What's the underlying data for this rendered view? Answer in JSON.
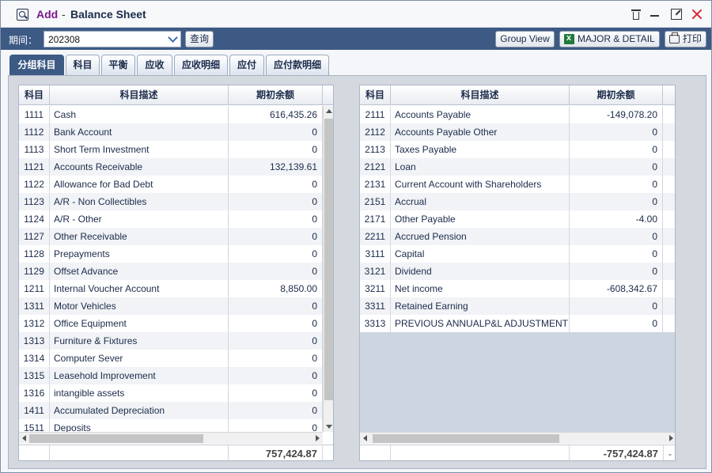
{
  "title": {
    "mode": "Add",
    "separator": "-",
    "name": "Balance Sheet"
  },
  "toolbar": {
    "period_label": "期间：",
    "period_value": "202308",
    "query_label": "查询",
    "group_view_label": "Group View",
    "major_detail_label": "MAJOR & DETAIL",
    "print_label": "打印"
  },
  "tabs": [
    {
      "label": "分组科目",
      "active": true
    },
    {
      "label": "科目"
    },
    {
      "label": "平衡"
    },
    {
      "label": "应收"
    },
    {
      "label": "应收明细"
    },
    {
      "label": "应付"
    },
    {
      "label": "应付款明细"
    }
  ],
  "columns": {
    "code": "科目",
    "desc": "科目描述",
    "amount": "期初余额"
  },
  "assets": {
    "rows": [
      {
        "code": "1111",
        "desc": "Cash",
        "amount": "616,435.26"
      },
      {
        "code": "1112",
        "desc": "Bank Account",
        "amount": "0"
      },
      {
        "code": "1113",
        "desc": "Short Term Investment",
        "amount": "0"
      },
      {
        "code": "1121",
        "desc": "Accounts Receivable",
        "amount": "132,139.61"
      },
      {
        "code": "1122",
        "desc": "Allowance for Bad Debt",
        "amount": "0"
      },
      {
        "code": "1123",
        "desc": "A/R - Non Collectibles",
        "amount": "0"
      },
      {
        "code": "1124",
        "desc": "A/R - Other",
        "amount": "0"
      },
      {
        "code": "1127",
        "desc": "Other Receivable",
        "amount": "0"
      },
      {
        "code": "1128",
        "desc": "Prepayments",
        "amount": "0"
      },
      {
        "code": "1129",
        "desc": "Offset Advance",
        "amount": "0"
      },
      {
        "code": "1211",
        "desc": "Internal Voucher Account",
        "amount": "8,850.00"
      },
      {
        "code": "1311",
        "desc": "Motor Vehicles",
        "amount": "0"
      },
      {
        "code": "1312",
        "desc": "Office Equipment",
        "amount": "0"
      },
      {
        "code": "1313",
        "desc": "Furniture & Fixtures",
        "amount": "0"
      },
      {
        "code": "1314",
        "desc": "Computer Sever",
        "amount": "0"
      },
      {
        "code": "1315",
        "desc": "Leasehold Improvement",
        "amount": "0"
      },
      {
        "code": "1316",
        "desc": "intangible assets",
        "amount": "0"
      },
      {
        "code": "1411",
        "desc": "Accumulated Depreciation",
        "amount": "0"
      },
      {
        "code": "1511",
        "desc": "Deposits",
        "amount": "0"
      }
    ],
    "total": "757,424.87"
  },
  "liabilities": {
    "rows": [
      {
        "code": "2111",
        "desc": "Accounts Payable",
        "amount": "-149,078.20"
      },
      {
        "code": "2112",
        "desc": "Accounts Payable Other",
        "amount": "0"
      },
      {
        "code": "2113",
        "desc": "Taxes Payable",
        "amount": "0"
      },
      {
        "code": "2121",
        "desc": "Loan",
        "amount": "0"
      },
      {
        "code": "2131",
        "desc": "Current Account with Shareholders",
        "amount": "0"
      },
      {
        "code": "2151",
        "desc": "Accrual",
        "amount": "0"
      },
      {
        "code": "2171",
        "desc": "Other Payable",
        "amount": "-4.00"
      },
      {
        "code": "2211",
        "desc": "Accrued Pension",
        "amount": "0"
      },
      {
        "code": "3111",
        "desc": "Capital",
        "amount": "0"
      },
      {
        "code": "3121",
        "desc": "Dividend",
        "amount": "0"
      },
      {
        "code": "3211",
        "desc": "Net income",
        "amount": "-608,342.67"
      },
      {
        "code": "3311",
        "desc": "Retained Earning",
        "amount": "0"
      },
      {
        "code": "3313",
        "desc": "PREVIOUS ANNUALP&L ADJUSTMENT",
        "amount": "0"
      }
    ],
    "total": "-757,424.87",
    "total_extra": "-"
  },
  "colors": {
    "toolbar": "#3d5a84",
    "accent_title": "#7a1a8a",
    "close": "#d9282f"
  },
  "icons": [
    "app-icon",
    "trash-icon",
    "minimize-icon",
    "maximize-icon",
    "close-icon",
    "chevron-down-icon",
    "excel-icon",
    "printer-icon"
  ]
}
